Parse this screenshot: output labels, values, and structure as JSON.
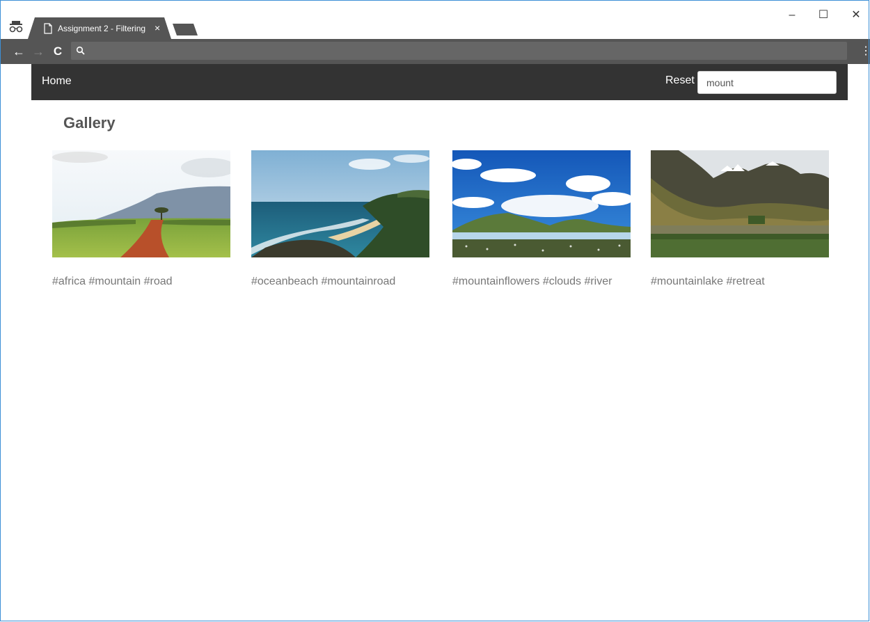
{
  "browser": {
    "tab_title": "Assignment 2 - Filtering",
    "tab_close": "×",
    "address": "",
    "window_controls": {
      "minimize": "–",
      "maximize": "☐",
      "close": "✕"
    },
    "nav": {
      "back": "←",
      "forward": "→",
      "reload": "C",
      "menu": "⋮"
    }
  },
  "navbar": {
    "home": "Home",
    "reset": "Reset",
    "search_value": "mount"
  },
  "gallery": {
    "title": "Gallery",
    "items": [
      {
        "tags": "#africa #mountain #road",
        "image": "africa-road-image"
      },
      {
        "tags": "#oceanbeach #mountainroad",
        "image": "ocean-beach-image"
      },
      {
        "tags": "#mountainflowers #clouds #river",
        "image": "mountain-flowers-image"
      },
      {
        "tags": "#mountainlake #retreat",
        "image": "mountain-lake-image"
      }
    ]
  },
  "icons": [
    "incognito-icon",
    "document-icon",
    "search-icon"
  ]
}
